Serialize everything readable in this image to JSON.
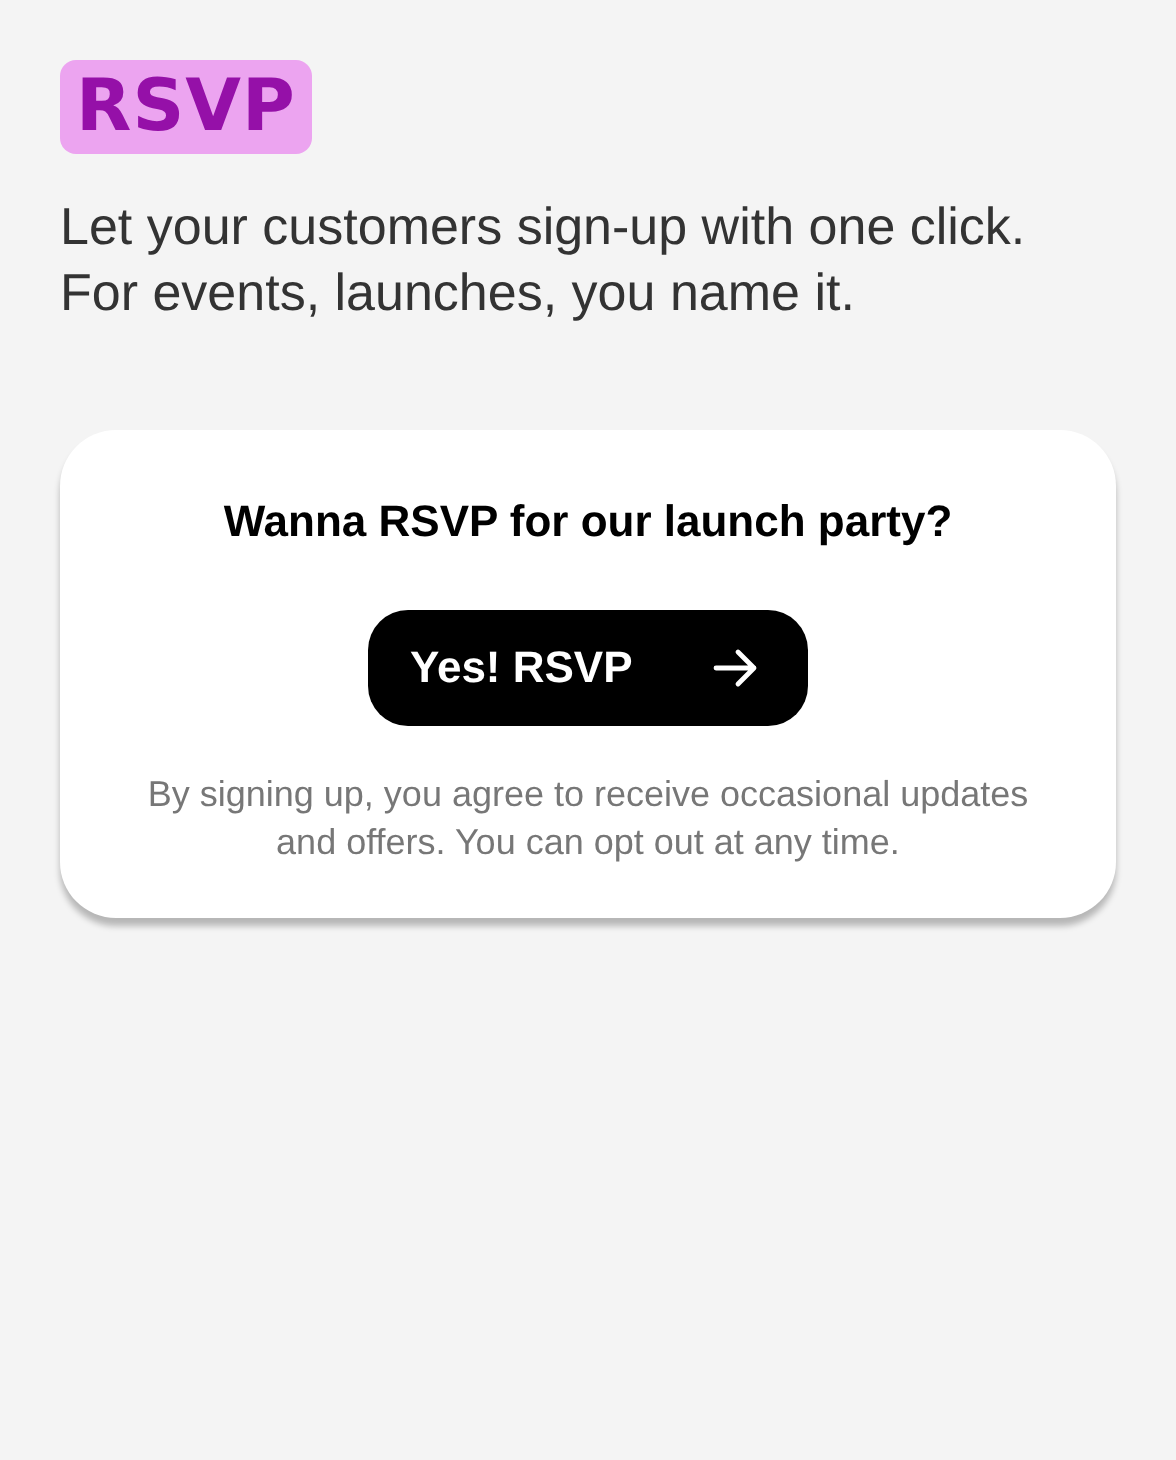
{
  "badge": "RSVP",
  "description": "Let your customers sign-up with one click. For events, launches, you name it.",
  "card": {
    "title": "Wanna RSVP for our launch party?",
    "button": {
      "label": "Yes! RSVP"
    },
    "disclaimer": "By signing up, you agree to receive occasional updates and offers. You can opt out at any time."
  }
}
